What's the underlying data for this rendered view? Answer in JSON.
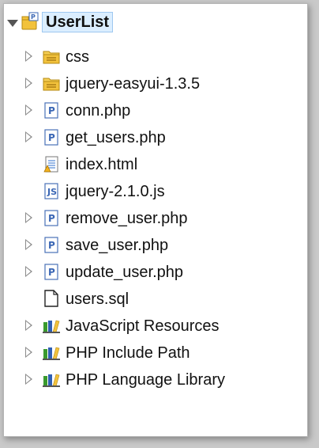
{
  "project": {
    "name": "UserList",
    "items": [
      {
        "label": "css",
        "icon": "folder-icon",
        "expandable": true
      },
      {
        "label": "jquery-easyui-1.3.5",
        "icon": "folder-icon",
        "expandable": true
      },
      {
        "label": "conn.php",
        "icon": "php-file-icon",
        "expandable": true
      },
      {
        "label": "get_users.php",
        "icon": "php-file-icon",
        "expandable": true
      },
      {
        "label": "index.html",
        "icon": "html-file-icon",
        "expandable": false
      },
      {
        "label": "jquery-2.1.0.js",
        "icon": "js-file-icon",
        "expandable": false
      },
      {
        "label": "remove_user.php",
        "icon": "php-file-icon",
        "expandable": true
      },
      {
        "label": "save_user.php",
        "icon": "php-file-icon",
        "expandable": true
      },
      {
        "label": "update_user.php",
        "icon": "php-file-icon",
        "expandable": true
      },
      {
        "label": "users.sql",
        "icon": "blank-file-icon",
        "expandable": false
      },
      {
        "label": "JavaScript Resources",
        "icon": "library-icon",
        "expandable": true
      },
      {
        "label": "PHP Include Path",
        "icon": "library-icon",
        "expandable": true
      },
      {
        "label": "PHP Language Library",
        "icon": "library-icon",
        "expandable": true
      }
    ]
  },
  "colors": {
    "selection": "#dbeeff",
    "selection_border": "#9ec8f0",
    "folder": "#f2c23c",
    "php_blue": "#3b67b5",
    "library_green": "#3a9a2e"
  }
}
